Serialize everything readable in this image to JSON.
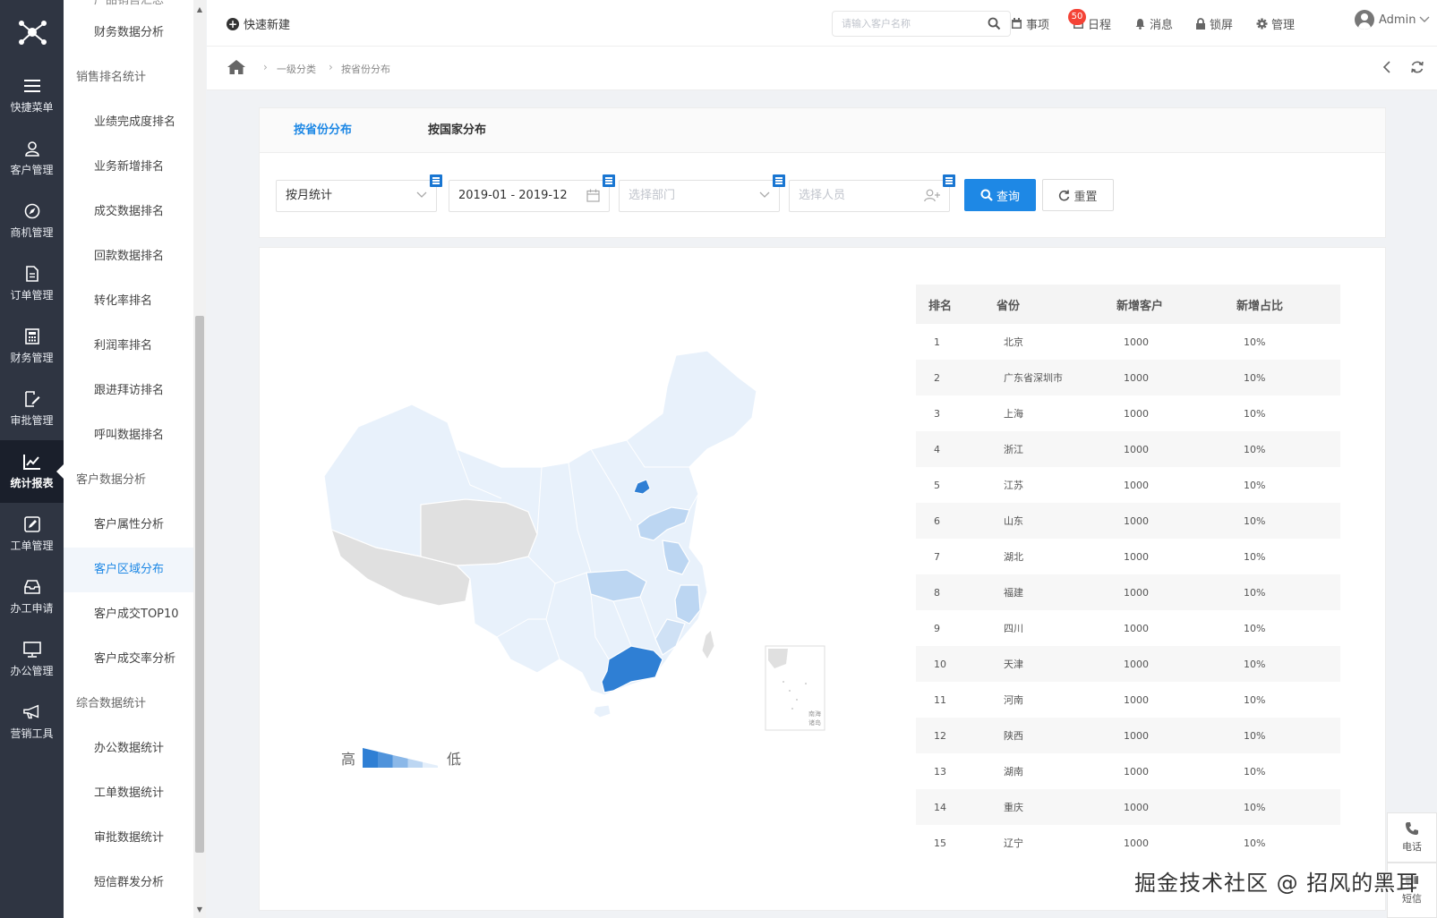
{
  "rail": {
    "items": [
      {
        "label": "快捷菜单",
        "icon": "menu-icon"
      },
      {
        "label": "客户管理",
        "icon": "user-icon"
      },
      {
        "label": "商机管理",
        "icon": "compass-icon"
      },
      {
        "label": "订单管理",
        "icon": "document-icon"
      },
      {
        "label": "财务管理",
        "icon": "calculator-icon"
      },
      {
        "label": "审批管理",
        "icon": "edit-document-icon"
      },
      {
        "label": "统计报表",
        "icon": "chart-icon"
      },
      {
        "label": "工单管理",
        "icon": "pencil-square-icon"
      },
      {
        "label": "办工申请",
        "icon": "inbox-icon"
      },
      {
        "label": "办公管理",
        "icon": "monitor-icon"
      },
      {
        "label": "营销工具",
        "icon": "megaphone-icon"
      }
    ],
    "active": "统计报表"
  },
  "submenu": {
    "clipped_top": "产品销售汇总",
    "entries": [
      {
        "type": "item",
        "label": "财务数据分析"
      },
      {
        "type": "group",
        "label": "销售排名统计"
      },
      {
        "type": "item",
        "label": "业绩完成度排名"
      },
      {
        "type": "item",
        "label": "业务新增排名"
      },
      {
        "type": "item",
        "label": "成交数据排名"
      },
      {
        "type": "item",
        "label": "回款数据排名"
      },
      {
        "type": "item",
        "label": "转化率排名"
      },
      {
        "type": "item",
        "label": "利润率排名"
      },
      {
        "type": "item",
        "label": "跟进拜访排名"
      },
      {
        "type": "item",
        "label": "呼叫数据排名"
      },
      {
        "type": "group",
        "label": "客户数据分析"
      },
      {
        "type": "item",
        "label": "客户属性分析"
      },
      {
        "type": "item",
        "label": "客户区域分布",
        "active": true
      },
      {
        "type": "item",
        "label": "客户成交TOP10"
      },
      {
        "type": "item",
        "label": "客户成交率分析"
      },
      {
        "type": "group",
        "label": "综合数据统计"
      },
      {
        "type": "item",
        "label": "办公数据统计"
      },
      {
        "type": "item",
        "label": "工单数据统计"
      },
      {
        "type": "item",
        "label": "审批数据统计"
      },
      {
        "type": "item",
        "label": "短信群发分析"
      }
    ]
  },
  "header": {
    "quick_new": "快速新建",
    "search_placeholder": "请输入客户名称",
    "todo": "事项",
    "todo_badge": "50",
    "schedule": "日程",
    "messages": "消息",
    "lock": "锁屏",
    "manage": "管理",
    "user": "Admin"
  },
  "breadcrumb": {
    "level1": "一级分类",
    "level2": "按省份分布"
  },
  "tabs": [
    {
      "label": "按省份分布",
      "active": true
    },
    {
      "label": "按国家分布",
      "active": false
    }
  ],
  "filters": {
    "period": "按月统计",
    "date_range": "2019-01 - 2019-12",
    "department_placeholder": "选择部门",
    "person_placeholder": "选择人员",
    "query": "查询",
    "reset": "重置"
  },
  "map": {
    "legend_high": "高",
    "legend_low": "低",
    "inset_label": "南海诸岛",
    "colors": {
      "high": "#2f7fd4",
      "mid": "#bcd6f2",
      "low": "#e8f1fb",
      "none": "#e0e0e0"
    }
  },
  "table": {
    "headers": [
      "排名",
      "省份",
      "新增客户",
      "新增占比"
    ],
    "rows": [
      [
        "1",
        "北京",
        "1000",
        "10%"
      ],
      [
        "2",
        "广东省深圳市",
        "1000",
        "10%"
      ],
      [
        "3",
        "上海",
        "1000",
        "10%"
      ],
      [
        "4",
        "浙江",
        "1000",
        "10%"
      ],
      [
        "5",
        "江苏",
        "1000",
        "10%"
      ],
      [
        "6",
        "山东",
        "1000",
        "10%"
      ],
      [
        "7",
        "湖北",
        "1000",
        "10%"
      ],
      [
        "8",
        "福建",
        "1000",
        "10%"
      ],
      [
        "9",
        "四川",
        "1000",
        "10%"
      ],
      [
        "10",
        "天津",
        "1000",
        "10%"
      ],
      [
        "11",
        "河南",
        "1000",
        "10%"
      ],
      [
        "12",
        "陕西",
        "1000",
        "10%"
      ],
      [
        "13",
        "湖南",
        "1000",
        "10%"
      ],
      [
        "14",
        "重庆",
        "1000",
        "10%"
      ],
      [
        "15",
        "辽宁",
        "1000",
        "10%"
      ]
    ]
  },
  "float": {
    "phone": "电话",
    "sms": "短信"
  },
  "watermark": "掘金技术社区 @ 招风的黑耳"
}
